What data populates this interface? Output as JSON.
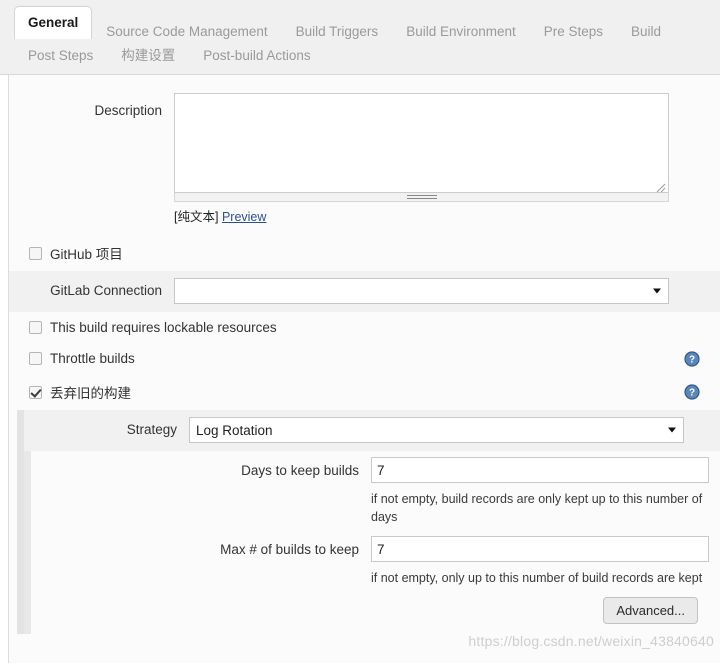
{
  "tabs": {
    "row1": [
      {
        "label": "General",
        "active": true
      },
      {
        "label": "Source Code Management",
        "active": false
      },
      {
        "label": "Build Triggers",
        "active": false
      },
      {
        "label": "Build Environment",
        "active": false
      },
      {
        "label": "Pre Steps",
        "active": false
      },
      {
        "label": "Build",
        "active": false
      }
    ],
    "row2": [
      {
        "label": "Post Steps",
        "active": false
      },
      {
        "label": "构建设置",
        "active": false
      },
      {
        "label": "Post-build Actions",
        "active": false
      }
    ]
  },
  "description": {
    "label": "Description",
    "value": "",
    "plain_text_tag": "[纯文本]",
    "preview_link": "Preview"
  },
  "github_project": {
    "label": "GitHub 项目",
    "checked": false
  },
  "gitlab_connection": {
    "label": "GitLab Connection",
    "value": "",
    "arrow_icon": "chevron-down-icon"
  },
  "lockable_resources": {
    "label": "This build requires lockable resources",
    "checked": false
  },
  "throttle_builds": {
    "label": "Throttle builds",
    "checked": false,
    "help_icon": "help-question-icon"
  },
  "discard_old_builds": {
    "label": "丢弃旧的构建",
    "checked": true,
    "help_icon": "help-question-icon"
  },
  "strategy": {
    "label": "Strategy",
    "value": "Log Rotation",
    "arrow_icon": "chevron-down-icon"
  },
  "days_to_keep": {
    "label": "Days to keep builds",
    "value": "7",
    "hint": "if not empty, build records are only kept up to this number of days"
  },
  "max_builds_to_keep": {
    "label": "Max # of builds to keep",
    "value": "7",
    "hint": "if not empty, only up to this number of build records are kept"
  },
  "advanced_button": {
    "label": "Advanced..."
  },
  "watermark": {
    "text": "https://blog.csdn.net/weixin_43840640"
  },
  "colors": {
    "accent_link": "#2b4f8f",
    "help_icon": "#3a6ea5",
    "page_bg": "#fbfbfb",
    "tab_bar_bg": "#f0f0f0",
    "row_shaded": "#f1f1f1"
  }
}
